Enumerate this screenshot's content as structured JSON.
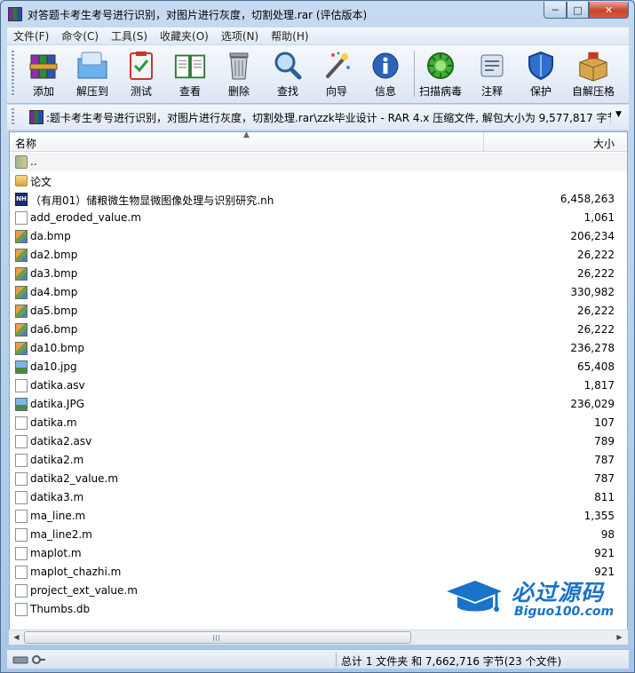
{
  "window": {
    "title": "对答题卡考生考号进行识别，对图片进行灰度，切割处理.rar (评估版本)",
    "minimize_glyph": "─",
    "maximize_glyph": "□",
    "close_glyph": "✕"
  },
  "menu": [
    "文件(F)",
    "命令(C)",
    "工具(S)",
    "收藏夹(O)",
    "选项(N)",
    "帮助(H)"
  ],
  "toolbar": [
    {
      "label": "添加",
      "icon": "add-archive-icon"
    },
    {
      "label": "解压到",
      "icon": "extract-folder-icon"
    },
    {
      "label": "测试",
      "icon": "test-clipboard-icon"
    },
    {
      "label": "查看",
      "icon": "view-book-icon"
    },
    {
      "label": "删除",
      "icon": "trash-icon"
    },
    {
      "label": "查找",
      "icon": "magnifier-icon"
    },
    {
      "label": "向导",
      "icon": "wizard-wand-icon"
    },
    {
      "label": "信息",
      "icon": "info-icon"
    },
    {
      "label": "扫描病毒",
      "icon": "virus-scan-icon"
    },
    {
      "label": "注释",
      "icon": "comment-icon"
    },
    {
      "label": "保护",
      "icon": "shield-icon"
    },
    {
      "label": "自解压格",
      "icon": "sfx-box-icon"
    }
  ],
  "address": {
    "path": ":题卡考生考号进行识别，对图片进行灰度，切割处理.rar\\zzk毕业设计 - RAR 4.x 压缩文件, 解包大小为 9,577,817 字节",
    "dropdown_glyph": "▼"
  },
  "columns": {
    "name": "名称",
    "size": "大小",
    "sort_glyph": "▲"
  },
  "files": [
    {
      "name": "..",
      "size": "",
      "type": "updir"
    },
    {
      "name": "论文",
      "size": "",
      "type": "folder"
    },
    {
      "name": "（有用01）储粮微生物显微图像处理与识别研究.nh",
      "size": "6,458,263",
      "type": "nh"
    },
    {
      "name": "add_eroded_value.m",
      "size": "1,061",
      "type": "doc"
    },
    {
      "name": "da.bmp",
      "size": "206,234",
      "type": "bmp"
    },
    {
      "name": "da2.bmp",
      "size": "26,222",
      "type": "bmp"
    },
    {
      "name": "da3.bmp",
      "size": "26,222",
      "type": "bmp"
    },
    {
      "name": "da4.bmp",
      "size": "330,982",
      "type": "bmp"
    },
    {
      "name": "da5.bmp",
      "size": "26,222",
      "type": "bmp"
    },
    {
      "name": "da6.bmp",
      "size": "26,222",
      "type": "bmp"
    },
    {
      "name": "da10.bmp",
      "size": "236,278",
      "type": "bmp"
    },
    {
      "name": "da10.jpg",
      "size": "65,408",
      "type": "jpg"
    },
    {
      "name": "datika.asv",
      "size": "1,817",
      "type": "doc"
    },
    {
      "name": "datika.JPG",
      "size": "236,029",
      "type": "jpg"
    },
    {
      "name": "datika.m",
      "size": "107",
      "type": "doc"
    },
    {
      "name": "datika2.asv",
      "size": "789",
      "type": "doc"
    },
    {
      "name": "datika2.m",
      "size": "787",
      "type": "doc"
    },
    {
      "name": "datika2_value.m",
      "size": "787",
      "type": "doc"
    },
    {
      "name": "datika3.m",
      "size": "811",
      "type": "doc"
    },
    {
      "name": "ma_line.m",
      "size": "1,355",
      "type": "doc"
    },
    {
      "name": "ma_line2.m",
      "size": "98",
      "type": "doc"
    },
    {
      "name": "maplot.m",
      "size": "921",
      "type": "doc"
    },
    {
      "name": "maplot_chazhi.m",
      "size": "921",
      "type": "doc"
    },
    {
      "name": "project_ext_value.m",
      "size": "",
      "type": "doc"
    },
    {
      "name": "Thumbs.db",
      "size": "",
      "type": "db"
    }
  ],
  "watermark": {
    "title": "必过源码",
    "url": "Biguo100.com"
  },
  "scrollbar": {
    "left_glyph": "◀",
    "right_glyph": "▶"
  },
  "status": {
    "summary": "总计 1 文件夹 和 7,662,716 字节(23 个文件)"
  }
}
